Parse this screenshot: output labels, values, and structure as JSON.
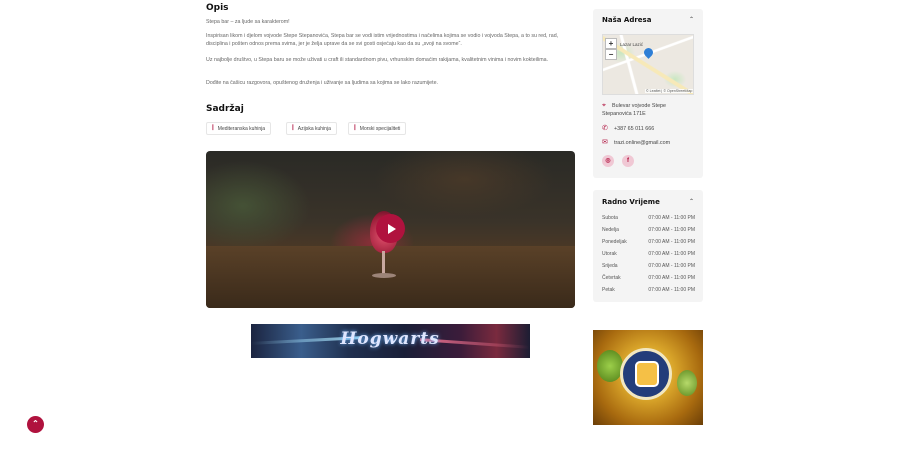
{
  "main": {
    "opis_title": "Opis",
    "paragraphs": [
      "Stepa bar – za ljude sa karakterom!",
      "Inspirisan likom i djelom vojvode Stepe Stepanovića, Stepa bar se vodi istim vrijednostima i načelima kojima se vodio i vojvoda Stepa, a to su red, rad, disciplina i pošten odnos prema svima, jer je želja uprave da se svi gosti osjećaju kao da su „svoji na svome“.",
      "Uz najbolje društvo, u Stepa baru se može uživati u craft ili standardnom pivu, vrhunskim domaćim rakijama, kvalitetnim vinima i novim kokteilima.",
      "Dođite na čašicu razgovora, opuštenog druženja i uživanje sa ljudima sa kojima se lako razumijete."
    ],
    "sadrzaj_title": "Sadržaj",
    "tags": [
      "Mediteranska kuhinja",
      "Azijska kuhinja",
      "Morski specijaliteti"
    ],
    "video": {
      "play_icon": "play-icon"
    },
    "banner_text": "Hogwarts"
  },
  "sidebar": {
    "address_card": {
      "title": "Naša Adresa",
      "caret": "⌃",
      "map": {
        "zoom_in": "+",
        "zoom_out": "−",
        "label": "Lazar Lazić",
        "attribution": "© Leaflet | © OpenStreetMap"
      },
      "address_line1": "Bulevar vojvode Stepe",
      "address_line2": "Stepanovića 171E",
      "phone": "+387 65 011 666",
      "email": "trazi.online@gmail.com",
      "socials": [
        "instagram-icon",
        "facebook-icon"
      ]
    },
    "hours_card": {
      "title": "Radno Vrijeme",
      "caret": "⌃",
      "rows": [
        {
          "day": "Subota",
          "hours": "07:00 AM - 11:00 PM"
        },
        {
          "day": "Nedelja",
          "hours": "07:00 AM - 11:00 PM"
        },
        {
          "day": "Ponedeljak",
          "hours": "07:00 AM - 11:00 PM"
        },
        {
          "day": "Utorak",
          "hours": "07:00 AM - 11:00 PM"
        },
        {
          "day": "Srijeda",
          "hours": "07:00 AM - 11:00 PM"
        },
        {
          "day": "Četvrtak",
          "hours": "07:00 AM - 11:00 PM"
        },
        {
          "day": "Petak",
          "hours": "07:00 AM - 11:00 PM"
        }
      ]
    }
  },
  "scroll_top": "⌃",
  "colors": {
    "accent": "#b0123e",
    "card_bg": "#f4f4f4"
  }
}
